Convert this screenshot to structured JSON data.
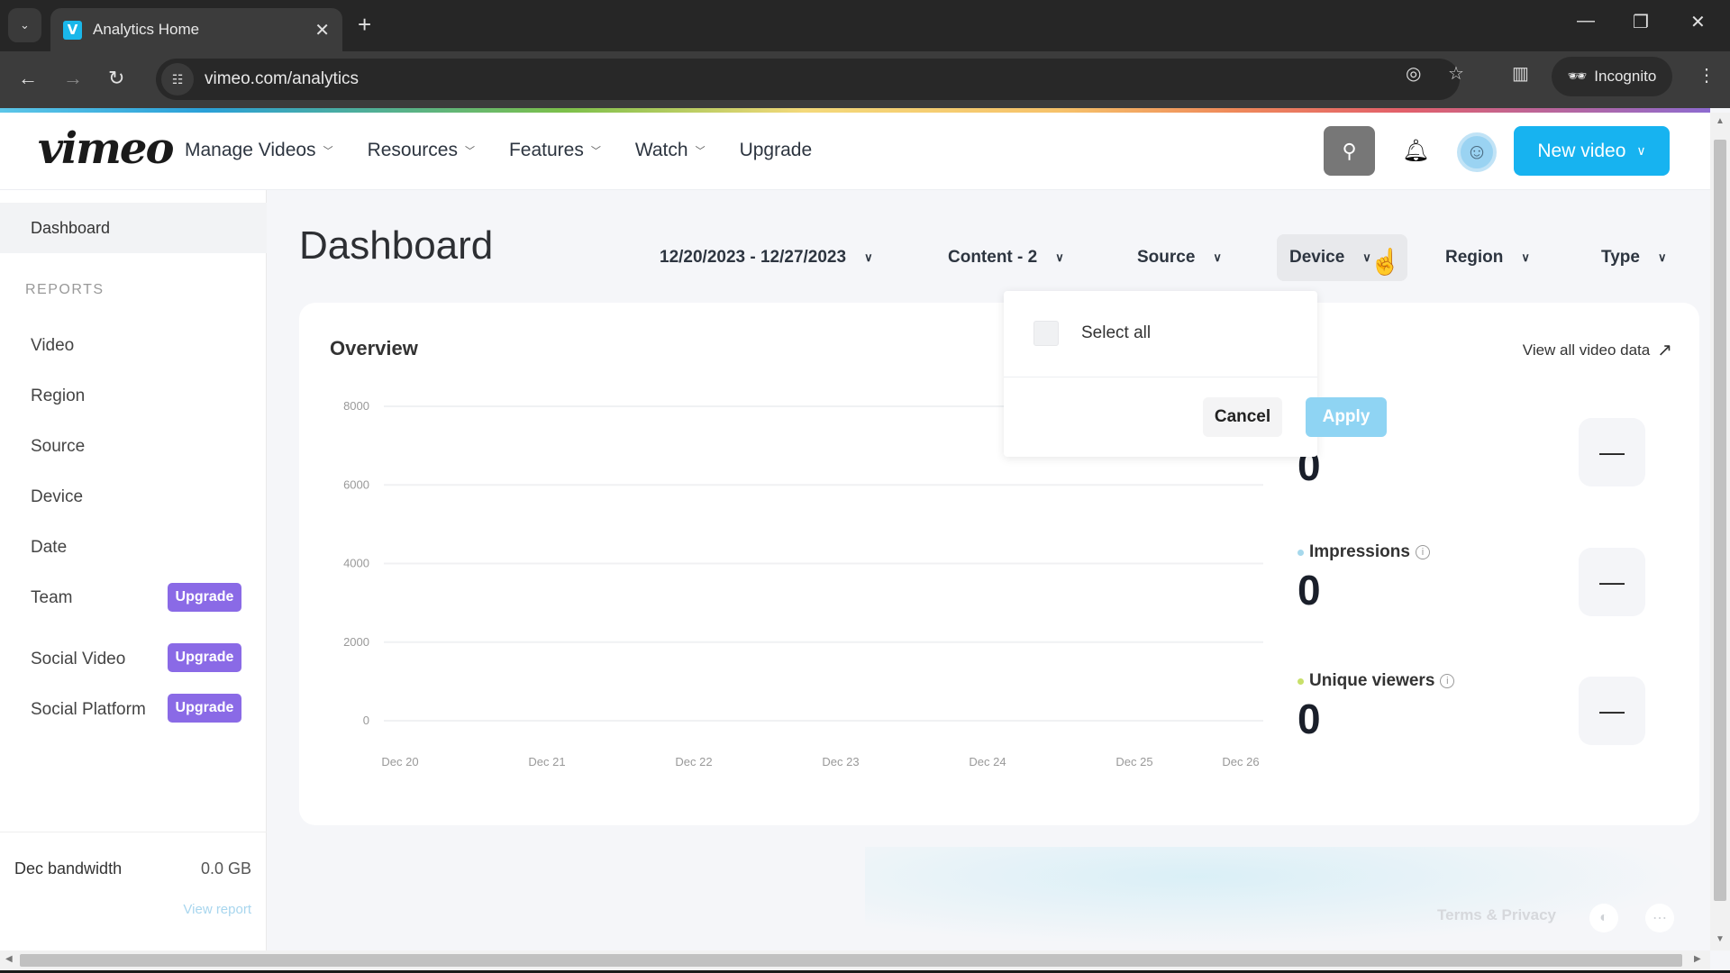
{
  "browser": {
    "tab_title": "Analytics Home",
    "favicon_letter": "V",
    "url": "vimeo.com/analytics",
    "incognito_label": "Incognito",
    "icons": {
      "tab_list": "chevron-down-icon",
      "close_tab": "close-icon",
      "new_tab": "plus-icon",
      "back": "arrow-left-icon",
      "forward": "arrow-right-icon",
      "reload": "reload-icon",
      "site_info": "tune-icon",
      "eye_off": "eye-off-icon",
      "bookmark": "star-icon",
      "side_panel": "side-panel-icon",
      "menu": "kebab-icon"
    }
  },
  "header": {
    "logo": "vimeo",
    "nav": [
      {
        "label": "Manage Videos",
        "has_dropdown": true
      },
      {
        "label": "Resources",
        "has_dropdown": true
      },
      {
        "label": "Features",
        "has_dropdown": true
      },
      {
        "label": "Watch",
        "has_dropdown": true
      },
      {
        "label": "Upgrade",
        "has_dropdown": false
      }
    ],
    "new_video_label": "New video",
    "brand_color": "#17b3f0"
  },
  "sidebar": {
    "dashboard_label": "Dashboard",
    "section_label": "REPORTS",
    "items": [
      {
        "label": "Video"
      },
      {
        "label": "Region"
      },
      {
        "label": "Source"
      },
      {
        "label": "Device"
      },
      {
        "label": "Date"
      },
      {
        "label": "Team",
        "badge": "Upgrade"
      },
      {
        "label": "Social Video",
        "badge": "Upgrade"
      },
      {
        "label": "Social Platform",
        "badge": "Upgrade"
      }
    ],
    "badge_color": "#8a6ae6",
    "bandwidth": {
      "label": "Dec bandwidth",
      "value": "0.0 GB",
      "link": "View report"
    }
  },
  "main": {
    "title": "Dashboard",
    "filters": [
      {
        "label": "12/20/2023 - 12/27/2023"
      },
      {
        "label": "Content - 2"
      },
      {
        "label": "Source"
      },
      {
        "label": "Device",
        "active": true
      },
      {
        "label": "Region"
      },
      {
        "label": "Type"
      }
    ],
    "device_dropdown": {
      "select_all_label": "Select all",
      "select_all_checked": false,
      "cancel_label": "Cancel",
      "apply_label": "Apply"
    },
    "overview": {
      "title": "Overview",
      "view_all_label": "View all video data",
      "metrics": [
        {
          "label": "",
          "value": "0",
          "color": ""
        },
        {
          "label": "Impressions",
          "value": "0",
          "color": "#a6d8ec"
        },
        {
          "label": "Unique viewers",
          "value": "0",
          "color": "#c8e06a"
        }
      ],
      "metric_toggle_symbol": "—"
    },
    "footer": {
      "terms_label": "Terms & Privacy"
    }
  },
  "chart_data": {
    "type": "line",
    "title": "Overview",
    "x": [
      "Dec 20",
      "Dec 21",
      "Dec 22",
      "Dec 23",
      "Dec 24",
      "Dec 25",
      "Dec 26"
    ],
    "series": [],
    "yticks": [
      0,
      2000,
      4000,
      6000,
      8000
    ],
    "ylim": [
      0,
      8000
    ],
    "xlabel": "",
    "ylabel": "",
    "grid": true
  }
}
